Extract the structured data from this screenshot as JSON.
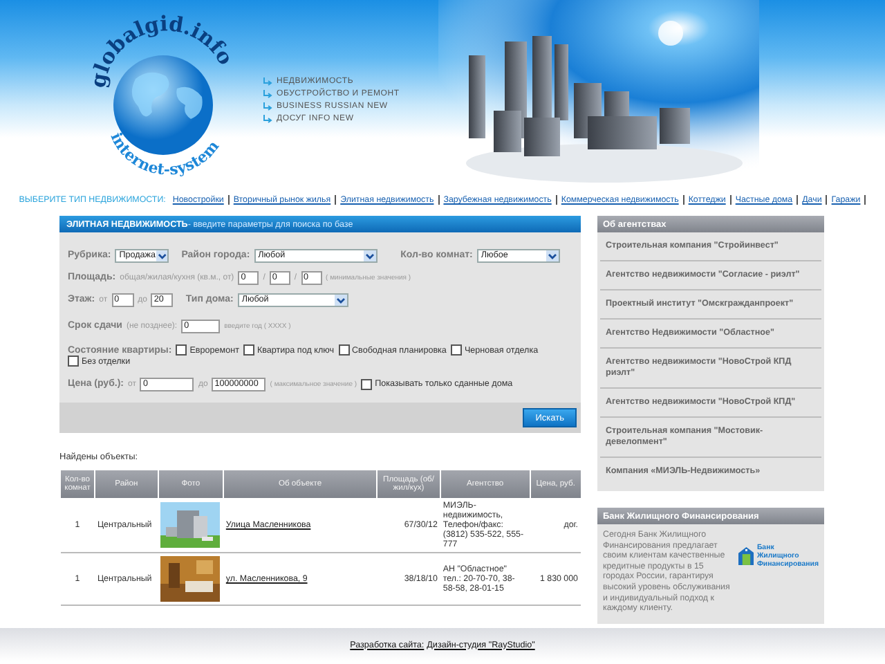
{
  "logo": {
    "top": "globalgid.info",
    "bottom": "internet-system"
  },
  "header_menu": [
    "НЕДВИЖИМОСТЬ",
    "ОБУСТРОЙСТВО И РЕМОНТ",
    "BUSINESS RUSSIAN NEW",
    "ДОСУГ INFO NEW"
  ],
  "type_nav": {
    "label": "ВЫБЕРИТЕ ТИП НЕДВИЖИМОСТИ:",
    "links": [
      "Новостройки",
      "Вторичный рынок жилья",
      "Элитная недвижимость",
      "Зарубежная недвижимость",
      "Коммерческая недвижимость",
      "Коттеджи",
      "Частные дома",
      "Дачи",
      "Гаражи"
    ]
  },
  "search_form": {
    "title": "ЭЛИТНАЯ НЕДВИЖИМОСТЬ",
    "subtitle": " - введите параметры для поиска по базе",
    "rubric": {
      "label": "Рубрика:",
      "value": "Продажа"
    },
    "district": {
      "label": "Район города:",
      "value": "Любой"
    },
    "rooms": {
      "label": "Кол-во комнат:",
      "value": "Любое"
    },
    "area": {
      "label": "Площадь:",
      "hint": "общая/жилая/кухня (кв.м., от)",
      "values": [
        "0",
        "0",
        "0"
      ],
      "separators": [
        "/",
        "/"
      ],
      "note": "( минимальные значения )"
    },
    "floor": {
      "label": "Этаж:",
      "from_label": "от",
      "from": "0",
      "to_label": "до",
      "to": "20"
    },
    "house_type": {
      "label": "Тип дома:",
      "value": "Любой"
    },
    "deadline": {
      "label": "Срок сдачи",
      "hint": "(не позднее):",
      "value": "0",
      "note": "введите год ( XXXX )"
    },
    "condition": {
      "label": "Состояние квартиры:",
      "options": [
        {
          "label": "Евроремонт",
          "checked": false
        },
        {
          "label": "Квартира под ключ",
          "checked": false
        },
        {
          "label": "Свободная планировка",
          "checked": false
        },
        {
          "label": "Черновая отделка",
          "checked": false
        },
        {
          "label": "Без отделки",
          "checked": false
        }
      ]
    },
    "price": {
      "label": "Цена (руб.):",
      "from_label": "от",
      "from": "0",
      "to_label": "до",
      "to": "100000000",
      "note": "( максимальное значение )"
    },
    "only_ready": {
      "label": "Показывать только сданные дома",
      "checked": false
    },
    "search_button": "Искать"
  },
  "results": {
    "title": "Найдены объекты:",
    "columns": [
      "Кол-во комнат",
      "Район",
      "Фото",
      "Об объекте",
      "Площадь (об/жил/кух)",
      "Агентство",
      "Цена, руб."
    ],
    "rows": [
      {
        "rooms": "1",
        "district": "Центральный",
        "photo": {
          "kind": "building"
        },
        "address": "Улица Масленникова",
        "area": "67/30/12",
        "agency": "МИЭЛЬ-недвижимость, Телефон/факс: (3812) 535-522, 555-777",
        "price": "дог."
      },
      {
        "rooms": "1",
        "district": "Центральный",
        "photo": {
          "kind": "room"
        },
        "address": "ул. Масленникова, 9",
        "area": "38/18/10",
        "agency": "АН \"Областное\" тел.: 20-70-70, 38-58-58, 28-01-15",
        "price": "1 830 000"
      }
    ]
  },
  "agencies": {
    "title": "Об агентствах",
    "items": [
      "Строительная компания \"Стройинвест\"",
      "Агентство недвижимости \"Согласие - риэлт\"",
      "Проектный институт \"Омскгражданпроект\"",
      "Агентство Недвижимости \"Областное\"",
      "Агентство недвижимости \"НовоСтрой КПД риэлт\"",
      "Агентство недвижимости \"НовоСтрой КПД\"",
      "Строительная компания \"Мостовик-девелопмент\"",
      "Компания «МИЭЛЬ-Недвижимость»"
    ]
  },
  "bank": {
    "title": "Банк Жилищного Финансирования",
    "text": "Сегодня Банк Жилищного Финансирования предлагает своим клиентам качественные кредитные продукты в 15 городах России, гарантируя высокий уровень обслуживания и индивидуальный подход к каждому клиенту.",
    "logo_lines": [
      "Банк",
      "Жилищного",
      "Финансирования"
    ]
  },
  "footer": {
    "label": "Разработка сайта:",
    "link": "Дизайн-студия \"RayStudio\""
  }
}
